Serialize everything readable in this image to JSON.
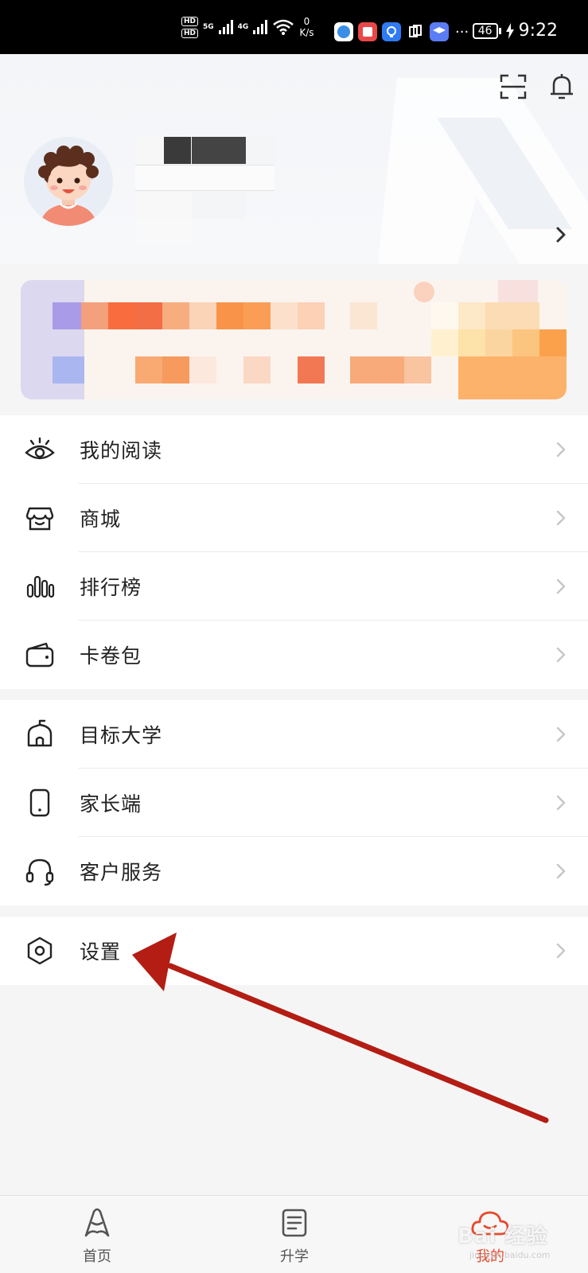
{
  "status_bar": {
    "hd1": "HD",
    "hd2": "HD",
    "net1": "5G",
    "net2": "4G",
    "speed_value": "0",
    "speed_unit": "K/s",
    "more": "···",
    "battery": "46",
    "time": "9:22"
  },
  "menu_group_1": [
    {
      "label": "我的阅读",
      "icon": "eye-icon"
    },
    {
      "label": "商城",
      "icon": "shop-icon"
    },
    {
      "label": "排行榜",
      "icon": "ranking-bars-icon"
    },
    {
      "label": "卡卷包",
      "icon": "wallet-icon"
    }
  ],
  "menu_group_2": [
    {
      "label": "目标大学",
      "icon": "university-icon"
    },
    {
      "label": "家长端",
      "icon": "phone-icon"
    },
    {
      "label": "客户服务",
      "icon": "headset-icon"
    }
  ],
  "menu_group_3": [
    {
      "label": "设置",
      "icon": "settings-hexagon-icon"
    }
  ],
  "bottom_nav": [
    {
      "label": "首页",
      "icon": "home-a-icon",
      "active": false
    },
    {
      "label": "升学",
      "icon": "document-icon",
      "active": false
    },
    {
      "label": "我的",
      "icon": "profile-cloud-icon",
      "active": true
    }
  ],
  "watermark": {
    "text": "Bai 经验",
    "sub": "jingyan.baidu.com"
  },
  "colors": {
    "accent": "#e54a2e",
    "annotation_arrow": "#b31d14",
    "background": "#f5f5f5"
  }
}
